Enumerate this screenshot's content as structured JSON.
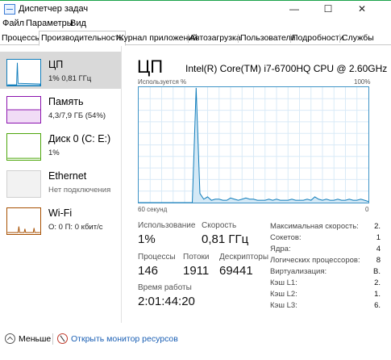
{
  "window": {
    "title": "Диспетчер задач",
    "minimize": "—",
    "maximize": "☐",
    "close": "✕"
  },
  "menu": {
    "file": "Файл",
    "options": "Параметры",
    "view": "Вид"
  },
  "tabs": [
    "Процессы",
    "Производительность",
    "Журнал приложений",
    "Автозагрузка",
    "Пользователи",
    "Подробности",
    "Службы"
  ],
  "sidebar": {
    "items": [
      {
        "title": "ЦП",
        "subtitle": "1% 0,81 ГГц",
        "color": "#117dbb"
      },
      {
        "title": "Память",
        "subtitle": "4,3/7,9 ГБ (54%)",
        "color": "#8b12ae"
      },
      {
        "title": "Диск 0 (C: E:)",
        "subtitle": "1%",
        "color": "#4da60c"
      },
      {
        "title": "Ethernet",
        "subtitle": "Нет подключения",
        "color": "#a7a7a7"
      },
      {
        "title": "Wi-Fi",
        "subtitle": "О: 0 П: 0 кбит/с",
        "color": "#a74f01"
      }
    ]
  },
  "cpu": {
    "title": "ЦП",
    "model": "Intel(R) Core(TM) i7-6700HQ CPU @ 2.60GHz",
    "graph_label": "Используется %",
    "graph_max": "100%",
    "time_label": "60 секунд",
    "zero": "0",
    "stats": {
      "usage_label": "Использование",
      "usage_value": "1%",
      "speed_label": "Скорость",
      "speed_value": "0,81 ГГц",
      "processes_label": "Процессы",
      "processes_value": "146",
      "threads_label": "Потоки",
      "threads_value": "1911",
      "handles_label": "Дескрипторы",
      "handles_value": "69441",
      "uptime_label": "Время работы",
      "uptime_value": "2:01:44:20"
    },
    "specs": [
      {
        "key": "Максимальная скорость:",
        "value": "2."
      },
      {
        "key": "Сокетов:",
        "value": "1"
      },
      {
        "key": "Ядра:",
        "value": "4"
      },
      {
        "key": "Логических процессоров:",
        "value": "8"
      },
      {
        "key": "Виртуализация:",
        "value": "В."
      },
      {
        "key": "Кэш L1:",
        "value": "2."
      },
      {
        "key": "Кэш L2:",
        "value": "1."
      },
      {
        "key": "Кэш L3:",
        "value": "6."
      }
    ]
  },
  "chart_data": {
    "type": "area",
    "title": "",
    "xlabel": "60 секунд",
    "ylabel": "Используется %",
    "ylim": [
      0,
      100
    ],
    "series": [
      {
        "values": [
          0,
          0,
          0,
          0,
          0,
          0,
          0,
          0,
          0,
          0,
          0,
          0,
          0,
          0,
          0,
          100,
          8,
          3,
          5,
          2,
          3,
          3,
          2,
          2,
          4,
          3,
          2,
          3,
          4,
          3,
          3,
          2,
          2,
          2,
          3,
          2,
          3,
          2,
          2,
          2,
          3,
          2,
          2,
          2,
          3,
          2,
          5,
          3,
          2,
          3,
          2,
          2,
          3,
          2,
          2,
          3,
          2,
          2,
          3,
          2,
          1
        ]
      }
    ]
  },
  "footer": {
    "less": "Меньше",
    "monitor": "Открыть монитор ресурсов"
  }
}
